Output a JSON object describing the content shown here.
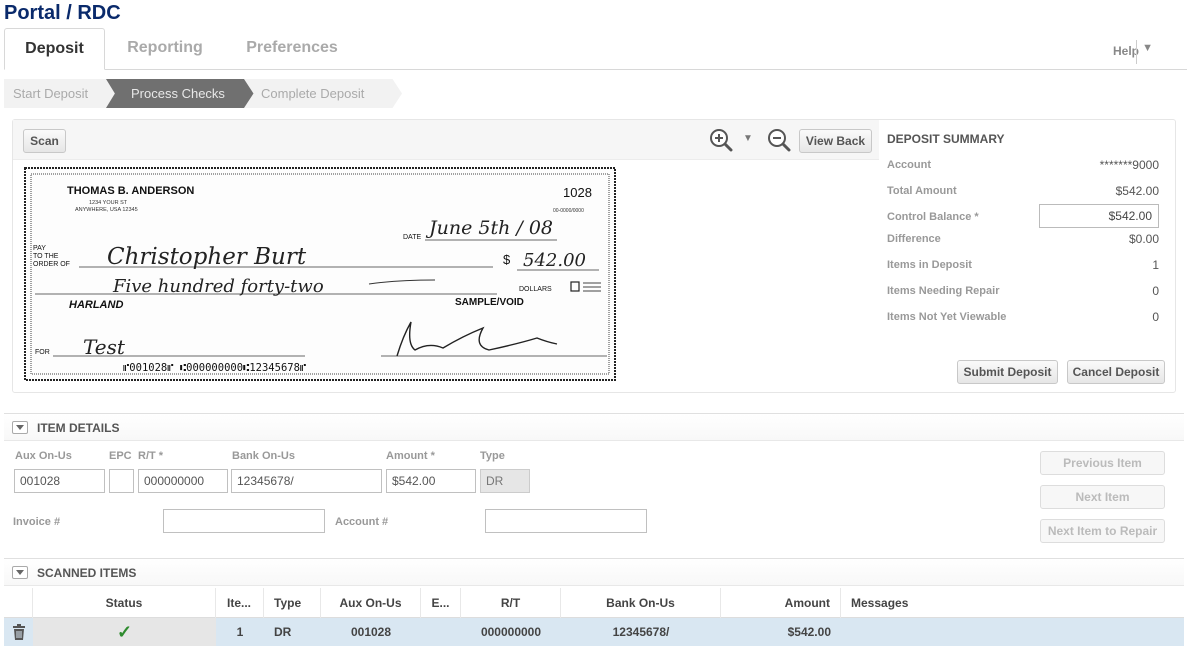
{
  "app": {
    "title": "Portal / RDC"
  },
  "tabs": [
    {
      "label": "Deposit",
      "active": true
    },
    {
      "label": "Reporting",
      "active": false
    },
    {
      "label": "Preferences",
      "active": false
    }
  ],
  "header": {
    "help_label": "Help",
    "help_arrow": "▼"
  },
  "steps": [
    {
      "label": "Start Deposit",
      "state": "done"
    },
    {
      "label": "Process Checks",
      "state": "current"
    },
    {
      "label": "Complete Deposit",
      "state": "pending"
    }
  ],
  "toolbar": {
    "scan_label": "Scan",
    "view_back_label": "View Back",
    "zoom_menu_arrow": "▼"
  },
  "check": {
    "payer_name": "THOMAS B. ANDERSON",
    "payer_address1": "1234 YOUR ST",
    "payer_address2": "ANYWHERE, USA 12345",
    "check_number": "1028",
    "fraction": "00-0000/0000",
    "date_label": "DATE",
    "date_value": "June 5th / 08",
    "pay_label1": "PAY",
    "pay_label2": "TO THE",
    "pay_label3": "ORDER OF",
    "payee": "Christopher Burt",
    "dollar_sign": "$",
    "amount_numeric": "542.00",
    "amount_written": "Five hundred forty-two",
    "dollars_label": "DOLLARS",
    "bank_name": "HARLAND",
    "sample_label": "SAMPLE/VOID",
    "memo_label": "FOR",
    "memo": "Test",
    "micr": "⑈001028⑈ ⑆000000000⑆12345678⑈"
  },
  "summary": {
    "heading": "DEPOSIT SUMMARY",
    "account_label": "Account",
    "account_value": "*******9000",
    "total_label": "Total Amount",
    "total_value": "$542.00",
    "control_label": "Control Balance *",
    "control_value": "$542.00",
    "difference_label": "Difference",
    "difference_value": "$0.00",
    "items_label": "Items in Deposit",
    "items_value": "1",
    "repair_label": "Items Needing Repair",
    "repair_value": "0",
    "not_viewable_label": "Items Not Yet Viewable",
    "not_viewable_value": "0",
    "submit_label": "Submit Deposit",
    "cancel_label": "Cancel Deposit"
  },
  "item_details": {
    "title": "ITEM DETAILS",
    "aux_label": "Aux On-Us",
    "aux_value": "001028",
    "epc_label": "EPC",
    "epc_value": "",
    "rt_label": "R/T *",
    "rt_value": "000000000",
    "bank_label": "Bank On-Us",
    "bank_value": "12345678/",
    "amount_label": "Amount *",
    "amount_value": "$542.00",
    "type_label": "Type",
    "type_value": "DR",
    "invoice_label": "Invoice #",
    "invoice_value": "",
    "account_label": "Account #",
    "account_value": "",
    "prev_label": "Previous Item",
    "next_label": "Next Item",
    "next_repair_label": "Next Item to Repair"
  },
  "scanned": {
    "title": "SCANNED ITEMS",
    "columns": [
      "Status",
      "Ite...",
      "Type",
      "Aux On-Us",
      "E...",
      "R/T",
      "Bank On-Us",
      "Amount",
      "Messages"
    ],
    "rows": [
      {
        "status": "✓",
        "item": "1",
        "type": "DR",
        "aux": "001028",
        "epc": "",
        "rt": "000000000",
        "bank": "12345678/",
        "amount": "$542.00",
        "messages": ""
      }
    ]
  },
  "colors": {
    "title": "#0a2a6b",
    "status_ok": "#2e8b2e",
    "row_selected": "#d9e7f2",
    "step_current": "#707070"
  }
}
